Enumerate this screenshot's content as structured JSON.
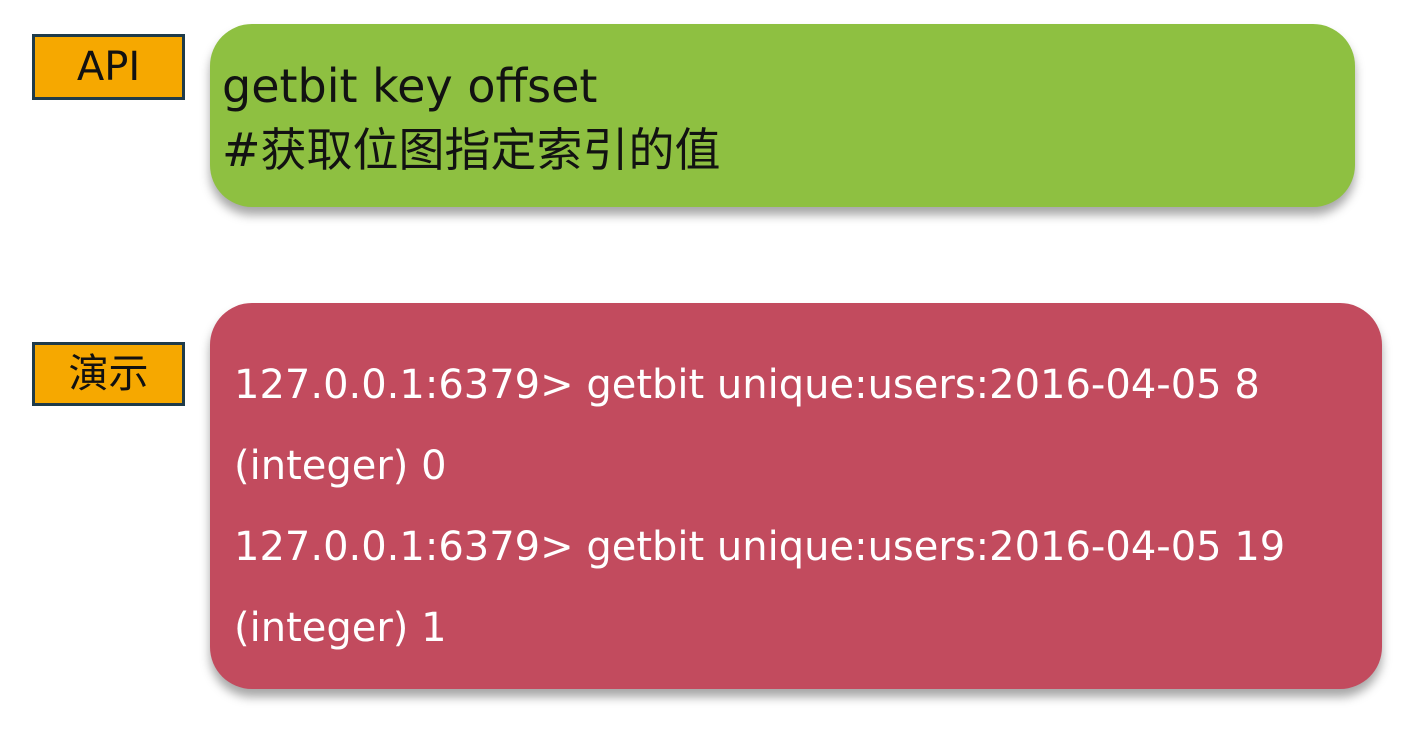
{
  "api_section": {
    "tag_label": "API",
    "command": "getbit key offset",
    "description": "#获取位图指定索引的值"
  },
  "demo_section": {
    "tag_label": "演示",
    "lines": [
      "127.0.0.1:6379> getbit unique:users:2016-04-05 8",
      "(integer) 0",
      "127.0.0.1:6379> getbit unique:users:2016-04-05 19",
      "(integer) 1"
    ]
  },
  "colors": {
    "tag_background": "#f6a800",
    "tag_border": "#1f3b4a",
    "api_card": "#8ec041",
    "demo_card": "#c24b5e"
  }
}
